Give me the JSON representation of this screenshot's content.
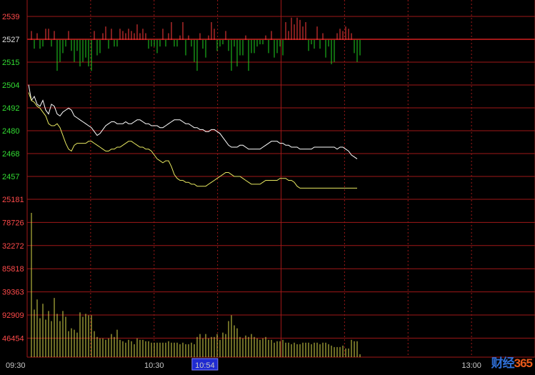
{
  "colors": {
    "background": "#000000",
    "grid": "#a01818",
    "axis_label_up": "#ff4a4a",
    "axis_label_flat": "#e0e0e0",
    "axis_label_down": "#33dd33",
    "axis_label_volume": "#ff4a4a",
    "price_line": "#ffffff",
    "avg_line": "#e8e860",
    "bar_up": "#ff3b3b",
    "bar_down": "#21d321",
    "volume_bar": "#d8d84a",
    "cursor_box": "#1f2bd1"
  },
  "watermark": {
    "part1": "财经",
    "part2": "365"
  },
  "chart_data": [
    {
      "type": "line",
      "title": "",
      "y_ticks": [
        "2539",
        "2527",
        "2515",
        "2504",
        "2492",
        "2480",
        "2468",
        "2457"
      ],
      "ylim": [
        2451,
        2545
      ],
      "reference": 2527,
      "x_ticks": [
        "09:30",
        "10:30",
        "10:54",
        "13:00"
      ],
      "x_highlight": "10:54",
      "x_range": [
        "09:30",
        "13:30"
      ],
      "series": [
        {
          "color": "#ffffff",
          "x": [
            0,
            1,
            2,
            3,
            4,
            5,
            6,
            7,
            8,
            9,
            10,
            11,
            12,
            13,
            14,
            15,
            16,
            17,
            18,
            19,
            20,
            21,
            22,
            23,
            24,
            25,
            26,
            27,
            28,
            29,
            30,
            31,
            32,
            33,
            34,
            35,
            36,
            37,
            38,
            39,
            40,
            41,
            42,
            43,
            44,
            45,
            46,
            47,
            48,
            49,
            50,
            51,
            52,
            53,
            54,
            55,
            56,
            57,
            58,
            59,
            60,
            61,
            62,
            63,
            64,
            65,
            66,
            67,
            68,
            69,
            70,
            71,
            72,
            73,
            74,
            75,
            76,
            77,
            78,
            79,
            80,
            81,
            82,
            83,
            84,
            85,
            86,
            87,
            88,
            89,
            90,
            91,
            92,
            93,
            94,
            95,
            96,
            97,
            98,
            99,
            100,
            101,
            102,
            103,
            104,
            105,
            106,
            107,
            108,
            109,
            110,
            111,
            112,
            113,
            114,
            115
          ],
          "values": [
            2504,
            2496,
            2498,
            2494,
            2493,
            2496,
            2491,
            2489,
            2494,
            2493,
            2489,
            2488,
            2490,
            2491,
            2492,
            2491,
            2488,
            2487,
            2486,
            2485,
            2484,
            2483,
            2482,
            2480,
            2478,
            2479,
            2481,
            2483,
            2484,
            2485,
            2485,
            2484,
            2484,
            2484,
            2485,
            2484,
            2484,
            2485,
            2486,
            2486,
            2485,
            2484,
            2484,
            2483,
            2483,
            2483,
            2482,
            2482,
            2483,
            2484,
            2485,
            2486,
            2486,
            2486,
            2485,
            2484,
            2484,
            2483,
            2482,
            2482,
            2481,
            2481,
            2480,
            2480,
            2481,
            2481,
            2480,
            2479,
            2477,
            2475,
            2473,
            2472,
            2472,
            2472,
            2473,
            2473,
            2472,
            2471,
            2471,
            2471,
            2471,
            2471,
            2472,
            2473,
            2474,
            2475,
            2475,
            2475,
            2474,
            2474,
            2473,
            2473,
            2472,
            2472,
            2472,
            2471,
            2471,
            2471,
            2471,
            2471,
            2472,
            2472,
            2472,
            2472,
            2472,
            2472,
            2472,
            2472,
            2471,
            2472,
            2472,
            2471,
            2470,
            2468,
            2467,
            2466
          ]
        },
        {
          "color": "#e8e860",
          "x": [
            0,
            1,
            2,
            3,
            4,
            5,
            6,
            7,
            8,
            9,
            10,
            11,
            12,
            13,
            14,
            15,
            16,
            17,
            18,
            19,
            20,
            21,
            22,
            23,
            24,
            25,
            26,
            27,
            28,
            29,
            30,
            31,
            32,
            33,
            34,
            35,
            36,
            37,
            38,
            39,
            40,
            41,
            42,
            43,
            44,
            45,
            46,
            47,
            48,
            49,
            50,
            51,
            52,
            53,
            54,
            55,
            56,
            57,
            58,
            59,
            60,
            61,
            62,
            63,
            64,
            65,
            66,
            67,
            68,
            69,
            70,
            71,
            72,
            73,
            74,
            75,
            76,
            77,
            78,
            79,
            80,
            81,
            82,
            83,
            84,
            85,
            86,
            87,
            88,
            89,
            90,
            91,
            92,
            93,
            94,
            95,
            96,
            97,
            98,
            99,
            100,
            101,
            102,
            103,
            104,
            105,
            106,
            107,
            108,
            109,
            110,
            111,
            112,
            113,
            114,
            115
          ],
          "values": [
            2500,
            2496,
            2495,
            2493,
            2492,
            2490,
            2488,
            2484,
            2483,
            2483,
            2484,
            2482,
            2478,
            2474,
            2471,
            2470,
            2473,
            2474,
            2474,
            2474,
            2474,
            2475,
            2475,
            2474,
            2473,
            2472,
            2471,
            2470,
            2470,
            2471,
            2471,
            2472,
            2472,
            2473,
            2474,
            2475,
            2475,
            2474,
            2473,
            2472,
            2472,
            2471,
            2471,
            2470,
            2468,
            2466,
            2465,
            2464,
            2465,
            2465,
            2462,
            2458,
            2456,
            2455,
            2455,
            2454,
            2454,
            2453,
            2453,
            2452,
            2452,
            2452,
            2452,
            2453,
            2454,
            2455,
            2456,
            2457,
            2458,
            2459,
            2459,
            2458,
            2457,
            2457,
            2457,
            2456,
            2455,
            2454,
            2453,
            2453,
            2453,
            2453,
            2454,
            2455,
            2455,
            2455,
            2455,
            2455,
            2456,
            2456,
            2456,
            2455,
            2455,
            2454,
            2452,
            2451,
            2451,
            2451,
            2451,
            2451,
            2451,
            2451,
            2451,
            2451,
            2451,
            2451,
            2451,
            2451,
            2451,
            2451,
            2451,
            2451,
            2451,
            2451,
            2451,
            2451
          ]
        }
      ],
      "bars": {
        "baseline": 2527,
        "x": [
          0,
          1,
          2,
          3,
          4,
          5,
          6,
          7,
          8,
          9,
          10,
          11,
          12,
          13,
          14,
          15,
          16,
          17,
          18,
          19,
          20,
          21,
          22,
          23,
          24,
          25,
          26,
          27,
          28,
          29,
          30,
          31,
          32,
          33,
          34,
          35,
          36,
          37,
          38,
          39,
          40,
          41,
          42,
          43,
          44,
          45,
          46,
          47,
          48,
          49,
          50,
          51,
          52,
          53,
          54,
          55,
          56,
          57,
          58,
          59,
          60,
          61,
          62,
          63,
          64,
          65,
          66,
          67,
          68,
          69,
          70,
          71,
          72,
          73,
          74,
          75,
          76,
          77,
          78,
          79,
          80,
          81,
          82,
          83,
          84,
          85,
          86,
          87,
          88,
          89,
          90,
          91,
          92,
          93,
          94,
          95,
          96,
          97,
          98,
          99,
          100,
          101,
          102,
          103,
          104,
          105,
          106,
          107,
          108,
          109,
          110,
          111,
          112,
          113,
          114,
          115
        ],
        "values": [
          4,
          -4,
          3,
          -4,
          -3,
          5,
          5,
          -3,
          4,
          -14,
          -10,
          -6,
          -3,
          4,
          -5,
          -10,
          -5,
          -12,
          -10,
          -8,
          -12,
          -14,
          4,
          -7,
          -6,
          3,
          6,
          -4,
          5,
          -3,
          -3,
          5,
          4,
          3,
          5,
          4,
          3,
          7,
          3,
          5,
          3,
          -4,
          -3,
          -3,
          -6,
          -3,
          5,
          -3,
          3,
          8,
          -3,
          -3,
          2,
          8,
          -7,
          2,
          -3,
          -10,
          -14,
          3,
          -4,
          -8,
          2,
          8,
          5,
          -5,
          -3,
          -2,
          4,
          -5,
          -14,
          -3,
          -12,
          -7,
          -7,
          2,
          -14,
          -6,
          -6,
          -3,
          -2,
          -2,
          2,
          -6,
          4,
          -8,
          -6,
          -3,
          -7,
          8,
          4,
          10,
          7,
          10,
          9,
          6,
          8,
          -5,
          -2,
          -4,
          6,
          -4,
          3,
          -8,
          -3,
          -11,
          -10,
          3,
          5,
          4,
          6,
          5,
          3,
          -6,
          -10,
          -7
        ]
      }
    },
    {
      "type": "bar",
      "title": "",
      "y_ticks": [
        "25181",
        "78726",
        "32272",
        "85818",
        "39363",
        "92909",
        "46454"
      ],
      "ylim": [
        0,
        100
      ],
      "x_ticks": [
        "09:30",
        "10:30",
        "10:54",
        "13:00"
      ],
      "series": [
        {
          "color": "#d8d84a",
          "x": [
            0,
            1,
            2,
            3,
            4,
            5,
            6,
            7,
            8,
            9,
            10,
            11,
            12,
            13,
            14,
            15,
            16,
            17,
            18,
            19,
            20,
            21,
            22,
            23,
            24,
            25,
            26,
            27,
            28,
            29,
            30,
            31,
            32,
            33,
            34,
            35,
            36,
            37,
            38,
            39,
            40,
            41,
            42,
            43,
            44,
            45,
            46,
            47,
            48,
            49,
            50,
            51,
            52,
            53,
            54,
            55,
            56,
            57,
            58,
            59,
            60,
            61,
            62,
            63,
            64,
            65,
            66,
            67,
            68,
            69,
            70,
            71,
            72,
            73,
            74,
            75,
            76,
            77,
            78,
            79,
            80,
            81,
            82,
            83,
            84,
            85,
            86,
            87,
            88,
            89,
            90,
            91,
            92,
            93,
            94,
            95,
            96,
            97,
            98,
            99,
            100,
            101,
            102,
            103,
            104,
            105,
            106,
            107,
            108,
            109,
            110,
            111,
            112,
            113,
            114,
            115
          ],
          "values": [
            100,
            33,
            40,
            27,
            37,
            26,
            32,
            25,
            41,
            30,
            25,
            32,
            28,
            18,
            20,
            19,
            17,
            31,
            28,
            30,
            29,
            29,
            18,
            14,
            13,
            13,
            12,
            13,
            16,
            14,
            19,
            12,
            11,
            10,
            12,
            11,
            9,
            13,
            12,
            12,
            11,
            11,
            10,
            10,
            10,
            10,
            10,
            10,
            11,
            10,
            10,
            10,
            9,
            10,
            9,
            9,
            10,
            9,
            14,
            16,
            13,
            16,
            13,
            14,
            14,
            16,
            12,
            17,
            16,
            25,
            29,
            22,
            20,
            14,
            13,
            15,
            14,
            16,
            14,
            13,
            12,
            13,
            14,
            12,
            12,
            10,
            11,
            11,
            12,
            10,
            10,
            9,
            10,
            9,
            9,
            10,
            10,
            10,
            9,
            10,
            10,
            9,
            10,
            10,
            9,
            8,
            7,
            7,
            7,
            8,
            6,
            6,
            12,
            11,
            11,
            2
          ]
        }
      ]
    }
  ]
}
